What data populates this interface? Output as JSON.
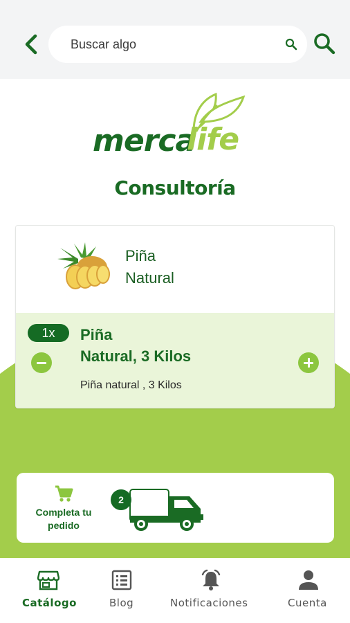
{
  "header": {
    "search_placeholder": "Buscar algo"
  },
  "brand": {
    "logo_text_dark": "merca",
    "logo_text_light": "life"
  },
  "page": {
    "title": "Consultoría"
  },
  "product": {
    "name_line1": "Piña",
    "name_line2": "Natural",
    "quantity": "1x",
    "detail_line1": "Piña",
    "detail_line2": "Natural, 3 Kilos",
    "description": "Piña natural , 3 Kilos"
  },
  "order": {
    "label_line1": "Completa tu",
    "label_line2": "pedido",
    "cart_count": "2"
  },
  "bottom_nav": {
    "items": [
      {
        "label": "Catálogo",
        "icon": "store-icon",
        "active": true
      },
      {
        "label": "Blog",
        "icon": "blog-list-icon",
        "active": false
      },
      {
        "label": "Notificaciones",
        "icon": "bell-icon",
        "active": false
      },
      {
        "label": "Cuenta",
        "icon": "user-icon",
        "active": false
      }
    ]
  },
  "colors": {
    "primary_green": "#1a6b24",
    "accent_green": "#8cc63f",
    "background_green": "#a3cd4b",
    "light_green": "#eaf5d9"
  }
}
